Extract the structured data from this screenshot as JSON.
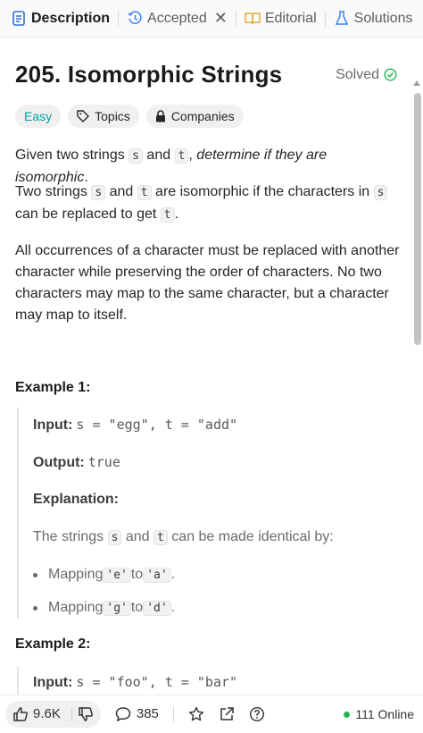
{
  "tabs": [
    {
      "label": "Description",
      "icon": "description-icon",
      "active": true
    },
    {
      "label": "Accepted",
      "icon": "history-icon"
    },
    {
      "label": "Editorial",
      "icon": "book-icon"
    },
    {
      "label": "Solutions",
      "icon": "flask-icon"
    }
  ],
  "problem": {
    "title": "205. Isomorphic Strings",
    "status": "Solved",
    "difficulty": "Easy",
    "tags": [
      "Topics",
      "Companies"
    ]
  },
  "description": {
    "p1": {
      "prefix": "Given two strings ",
      "s": "s",
      "and": " and ",
      "t": "t",
      "comma": ", ",
      "italic": "determine if they are isomorphic",
      "period": "."
    },
    "p2": {
      "prefix": "Two strings ",
      "s": "s",
      "and": " and ",
      "t": "t",
      "mid": " are isomorphic if the characters in ",
      "s2": "s",
      "br": " can be replaced to get ",
      "t2": "t",
      "period": "."
    },
    "p3": "All occurrences of a character must be replaced with another character while preserving the order of characters. No two characters may map to the same character, but a character may map to itself."
  },
  "examples": [
    {
      "title": "Example 1:",
      "input_label": "Input:",
      "input": "s = \"egg\", t = \"add\"",
      "output_label": "Output:",
      "output": "true",
      "explanation_label": "Explanation:",
      "explanation_prefix": "The strings ",
      "explanation_s": "s",
      "explanation_and": " and ",
      "explanation_t": "t",
      "explanation_suffix": " can be made identical by:",
      "bullets": [
        {
          "pre": "Mapping ",
          "from": "'e'",
          "to_word": " to ",
          "to": "'a'",
          "end": "."
        },
        {
          "pre": "Mapping ",
          "from": "'g'",
          "to_word": " to ",
          "to": "'d'",
          "end": "."
        }
      ]
    },
    {
      "title": "Example 2:",
      "input_label": "Input:",
      "input": "s = \"foo\", t = \"bar\""
    }
  ],
  "bottom": {
    "likes": "9.6K",
    "comments": "385",
    "online": "111 Online"
  },
  "colors": {
    "easy": "#00a0a0",
    "solved": "#2cbb5d",
    "online_dot": "#22b455"
  }
}
